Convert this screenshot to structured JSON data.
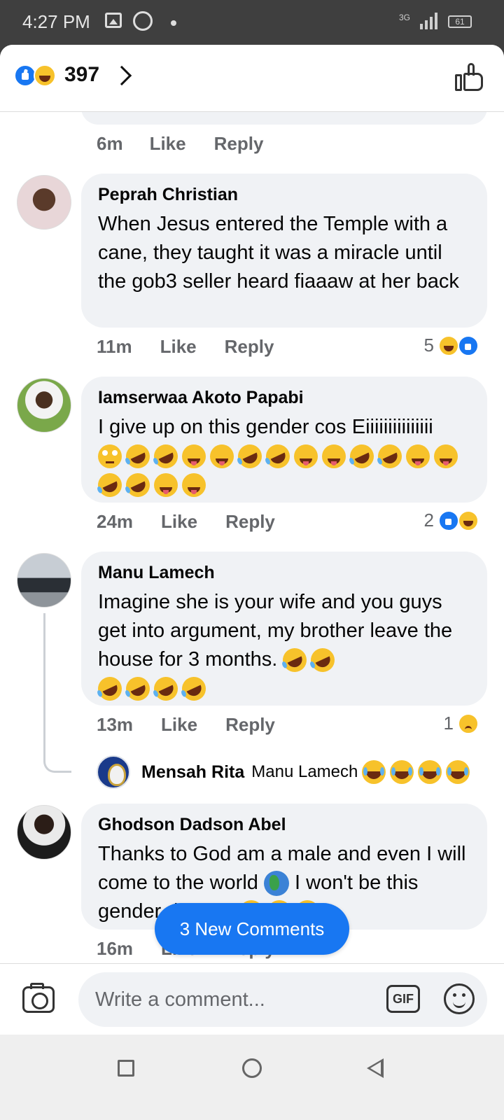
{
  "status_bar": {
    "time": "4:27 PM",
    "network": "3G",
    "battery": "61"
  },
  "header": {
    "reaction_count": "397"
  },
  "previous_comment": {
    "time": "6m",
    "like_label": "Like",
    "reply_label": "Reply"
  },
  "comments": [
    {
      "name": "Peprah Christian",
      "text": "When Jesus entered the Temple with a cane, they taught it was a miracle until the gob3 seller heard fiaaaw at her back",
      "time": "11m",
      "like_label": "Like",
      "reply_label": "Reply",
      "reaction_count": "5",
      "reactions": [
        "haha-icon",
        "like-icon"
      ]
    },
    {
      "name": "Iamserwaa Akoto Papabi",
      "text": "I give up on this gender cos Eiiiiiiiiiiiiiii",
      "emojis": [
        "eyeroll",
        "rofl",
        "rofl",
        "squint",
        "squint",
        "rofl",
        "rofl",
        "squint",
        "squint",
        "rofl",
        "rofl",
        "squint",
        "squint",
        "rofl",
        "rofl",
        "squint",
        "squint"
      ],
      "time": "24m",
      "like_label": "Like",
      "reply_label": "Reply",
      "reaction_count": "2",
      "reactions": [
        "like-icon",
        "haha-icon"
      ]
    },
    {
      "name": "Manu Lamech",
      "text": "Imagine she is your wife and you guys get into argument, my brother leave the house for 3 months.",
      "emojis": [
        "rofl",
        "rofl",
        "rofl",
        "rofl",
        "rofl",
        "rofl"
      ],
      "time": "13m",
      "like_label": "Like",
      "reply_label": "Reply",
      "reaction_count": "1",
      "reactions": [
        "sad-icon"
      ]
    },
    {
      "name": "Ghodson Dadson Abel",
      "text_before_globe": "Thanks to God am a male and even I will come to the world",
      "text_after_globe": "I won't be this gender dosuuu",
      "emojis": [
        "joy",
        "joy",
        "zip"
      ],
      "time": "16m",
      "like_label": "Like",
      "reply_label": "Reply"
    }
  ],
  "reply": {
    "name": "Mensah Rita",
    "mention": "Manu Lamech",
    "emojis": [
      "joy",
      "joy",
      "joy",
      "joy"
    ]
  },
  "new_comments_pill": "3 New Comments",
  "composer": {
    "placeholder": "Write a comment...",
    "gif_label": "GIF"
  }
}
